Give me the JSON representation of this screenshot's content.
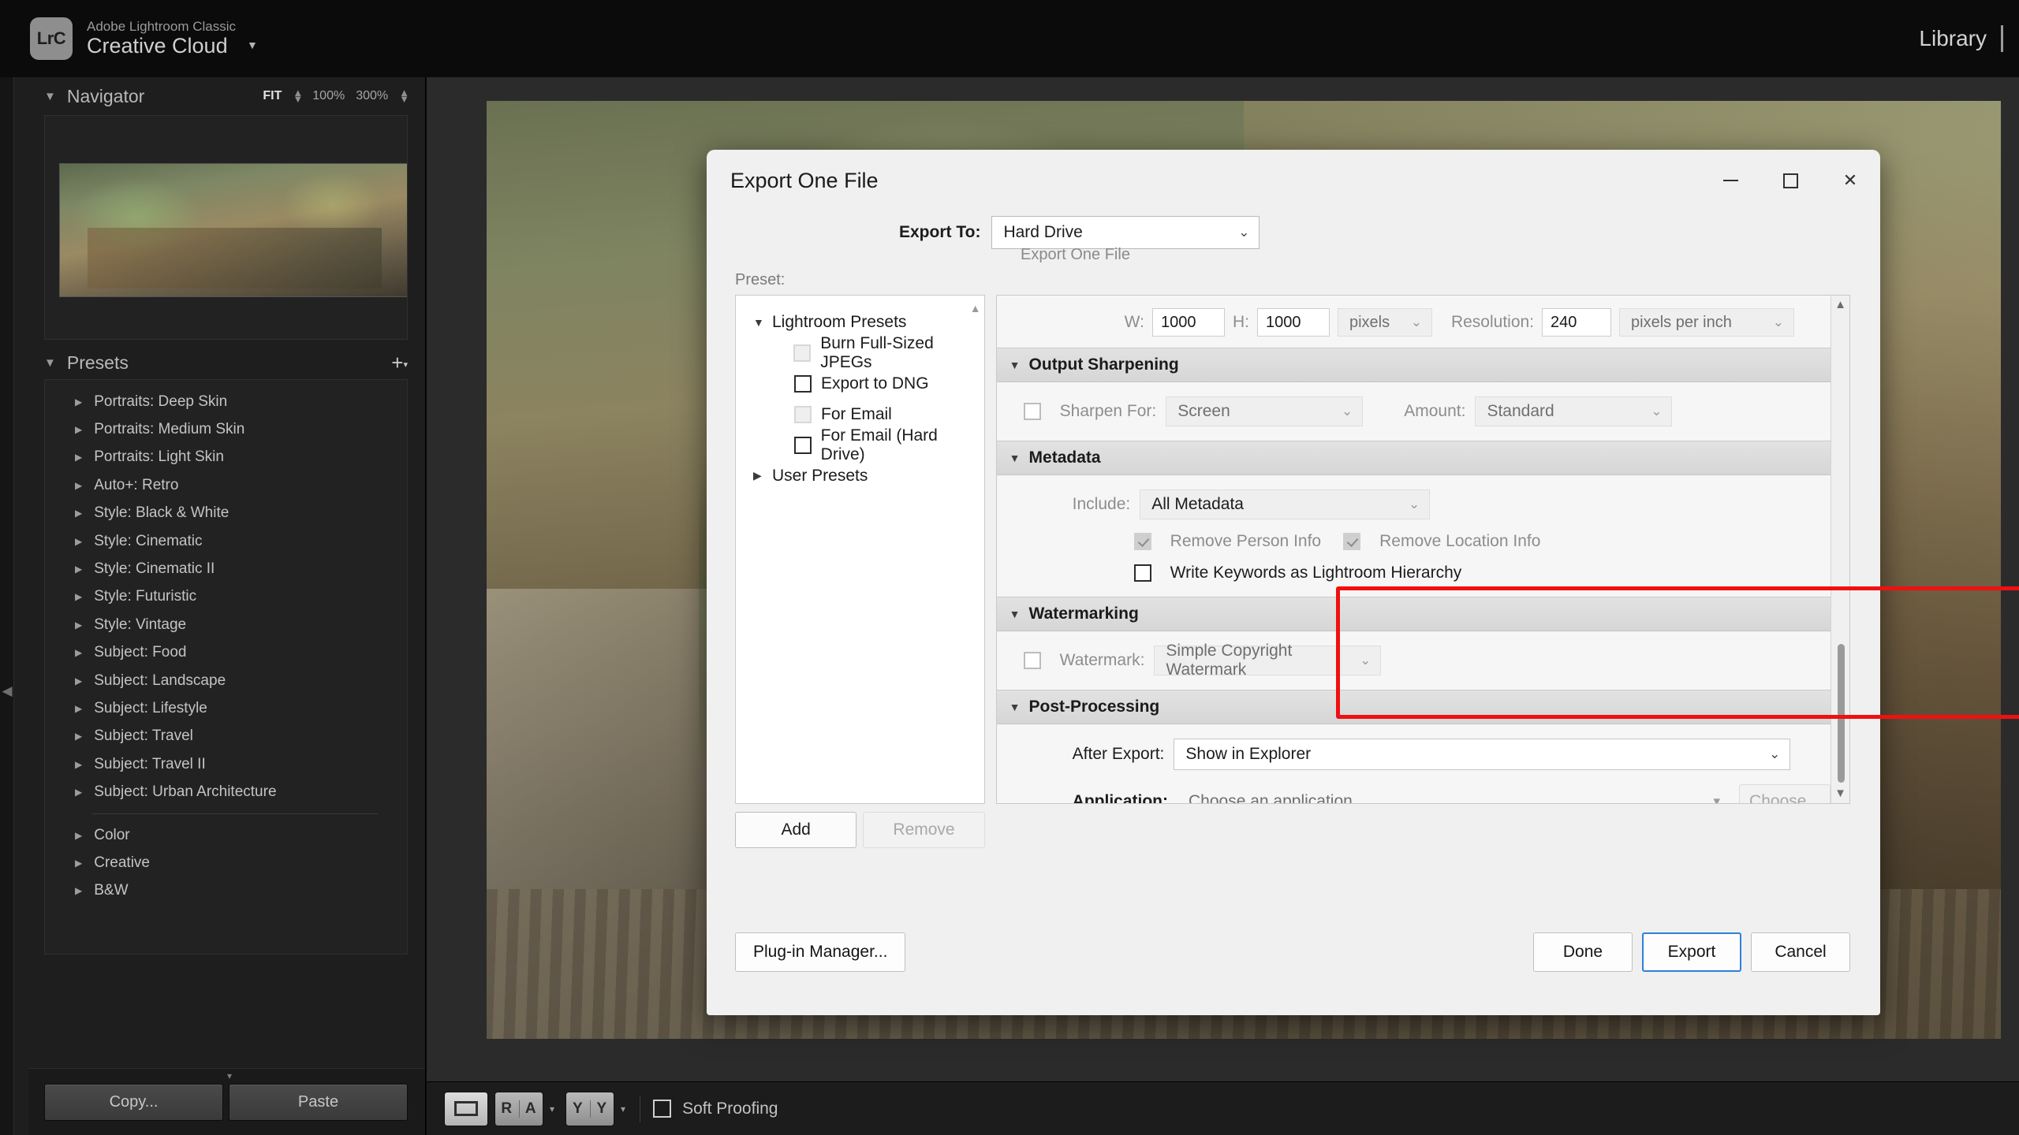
{
  "titlebar": {
    "badge": "LrC",
    "product_line1": "Adobe Lightroom Classic",
    "product_line2": "Creative Cloud",
    "caret": "▼",
    "module": "Library"
  },
  "navigator": {
    "title": "Navigator",
    "tri": "▼",
    "fit": "FIT",
    "zoom_100": "100%",
    "zoom_300": "300%"
  },
  "presets_panel": {
    "title": "Presets",
    "tri": "▼",
    "add": "+",
    "items": [
      {
        "label": "Portraits: Deep Skin"
      },
      {
        "label": "Portraits: Medium Skin"
      },
      {
        "label": "Portraits: Light Skin"
      },
      {
        "label": "Auto+: Retro"
      },
      {
        "label": "Style: Black & White"
      },
      {
        "label": "Style: Cinematic"
      },
      {
        "label": "Style: Cinematic II"
      },
      {
        "label": "Style: Futuristic"
      },
      {
        "label": "Style: Vintage"
      },
      {
        "label": "Subject: Food"
      },
      {
        "label": "Subject: Landscape"
      },
      {
        "label": "Subject: Lifestyle"
      },
      {
        "label": "Subject: Travel"
      },
      {
        "label": "Subject: Travel II"
      },
      {
        "label": "Subject: Urban Architecture"
      }
    ],
    "items_after_divider": [
      {
        "label": "Color"
      },
      {
        "label": "Creative"
      },
      {
        "label": "B&W"
      }
    ]
  },
  "left_footer": {
    "copy": "Copy...",
    "paste": "Paste"
  },
  "toolbar": {
    "loupe": "loupe-view",
    "compare": [
      "R",
      "A"
    ],
    "survey": [
      "Y",
      "Y"
    ],
    "soft_proofing": "Soft Proofing"
  },
  "dialog": {
    "title": "Export One File",
    "export_to_label": "Export To:",
    "export_to_value": "Hard Drive",
    "subtitle": "Export One File",
    "preset_caption": "Preset:",
    "preset_tree": [
      {
        "label": "Lightroom Presets",
        "level": 0,
        "tri": "▼",
        "checkbox": null
      },
      {
        "label": "Burn Full-Sized JPEGs",
        "level": 1,
        "tri": "",
        "checkbox": "off"
      },
      {
        "label": "Export to DNG",
        "level": 1,
        "tri": "",
        "checkbox": "empty"
      },
      {
        "label": "For Email",
        "level": 1,
        "tri": "",
        "checkbox": "off"
      },
      {
        "label": "For Email (Hard Drive)",
        "level": 1,
        "tri": "",
        "checkbox": "empty"
      },
      {
        "label": "User Presets",
        "level": 0,
        "tri": "▶",
        "checkbox": null
      }
    ],
    "preset_add": "Add",
    "preset_remove": "Remove",
    "image_sizing": {
      "w_label": "W:",
      "w_value": "1000",
      "h_label": "H:",
      "h_value": "1000",
      "unit": "pixels",
      "resolution_label": "Resolution:",
      "resolution_value": "240",
      "resolution_unit": "pixels per inch"
    },
    "output_sharpening": {
      "title": "Output Sharpening",
      "sharpen_for_label": "Sharpen For:",
      "sharpen_for_value": "Screen",
      "amount_label": "Amount:",
      "amount_value": "Standard"
    },
    "metadata": {
      "title": "Metadata",
      "include_label": "Include:",
      "include_value": "All Metadata",
      "remove_person_info": "Remove Person Info",
      "remove_location_info": "Remove Location Info",
      "write_keywords": "Write Keywords as Lightroom Hierarchy",
      "highlight_color": "#f01010"
    },
    "watermarking": {
      "title": "Watermarking",
      "watermark_label": "Watermark:",
      "watermark_value": "Simple Copyright Watermark"
    },
    "post_processing": {
      "title": "Post-Processing",
      "after_export_label": "After Export:",
      "after_export_value": "Show in Explorer",
      "application_label": "Application:",
      "application_value": "Choose an application...",
      "choose_button": "Choose..."
    },
    "footer": {
      "plugin_manager": "Plug-in Manager...",
      "done": "Done",
      "export": "Export",
      "cancel": "Cancel"
    }
  }
}
